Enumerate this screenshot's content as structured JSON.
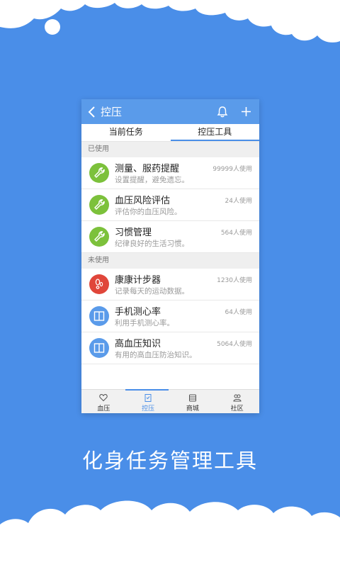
{
  "colors": {
    "background": "#4a8ee8",
    "appbar": "#5a9bea",
    "green": "#7cc13b",
    "red": "#e0463a",
    "blue": "#5a9bea"
  },
  "appbar": {
    "title": "控压",
    "back_icon": "chevron-left-icon",
    "bell_icon": "bell-icon",
    "plus_icon": "plus-icon"
  },
  "tabs": [
    {
      "label": "当前任务",
      "active": false
    },
    {
      "label": "控压工具",
      "active": true
    }
  ],
  "sections": {
    "used": {
      "title": "已使用",
      "items": [
        {
          "name": "测量、服药提醒",
          "desc": "设置提醒，避免遗忘。",
          "usage": "99999人使用",
          "icon": "wrench-icon"
        },
        {
          "name": "血压风险评估",
          "desc": "评估你的血压风险。",
          "usage": "24人使用",
          "icon": "wrench-icon"
        },
        {
          "name": "习惯管理",
          "desc": "纪律良好的生活习惯。",
          "usage": "564人使用",
          "icon": "wrench-icon"
        }
      ]
    },
    "unused": {
      "title": "未使用",
      "items": [
        {
          "name": "康康计步器",
          "desc": "记录每天的运动数据。",
          "usage": "1230人使用",
          "icon": "footprints-icon"
        },
        {
          "name": "手机测心率",
          "desc": "利用手机测心率。",
          "usage": "64人使用",
          "icon": "book-icon"
        },
        {
          "name": "高血压知识",
          "desc": "有用的高血压防治知识。",
          "usage": "5064人使用",
          "icon": "book-icon"
        }
      ]
    }
  },
  "bottom_nav": [
    {
      "label": "血压",
      "icon": "heart-icon",
      "active": false
    },
    {
      "label": "控压",
      "icon": "clipboard-icon",
      "active": true
    },
    {
      "label": "商城",
      "icon": "store-icon",
      "active": false
    },
    {
      "label": "社区",
      "icon": "community-icon",
      "active": false
    }
  ],
  "slogan": "化身任务管理工具"
}
